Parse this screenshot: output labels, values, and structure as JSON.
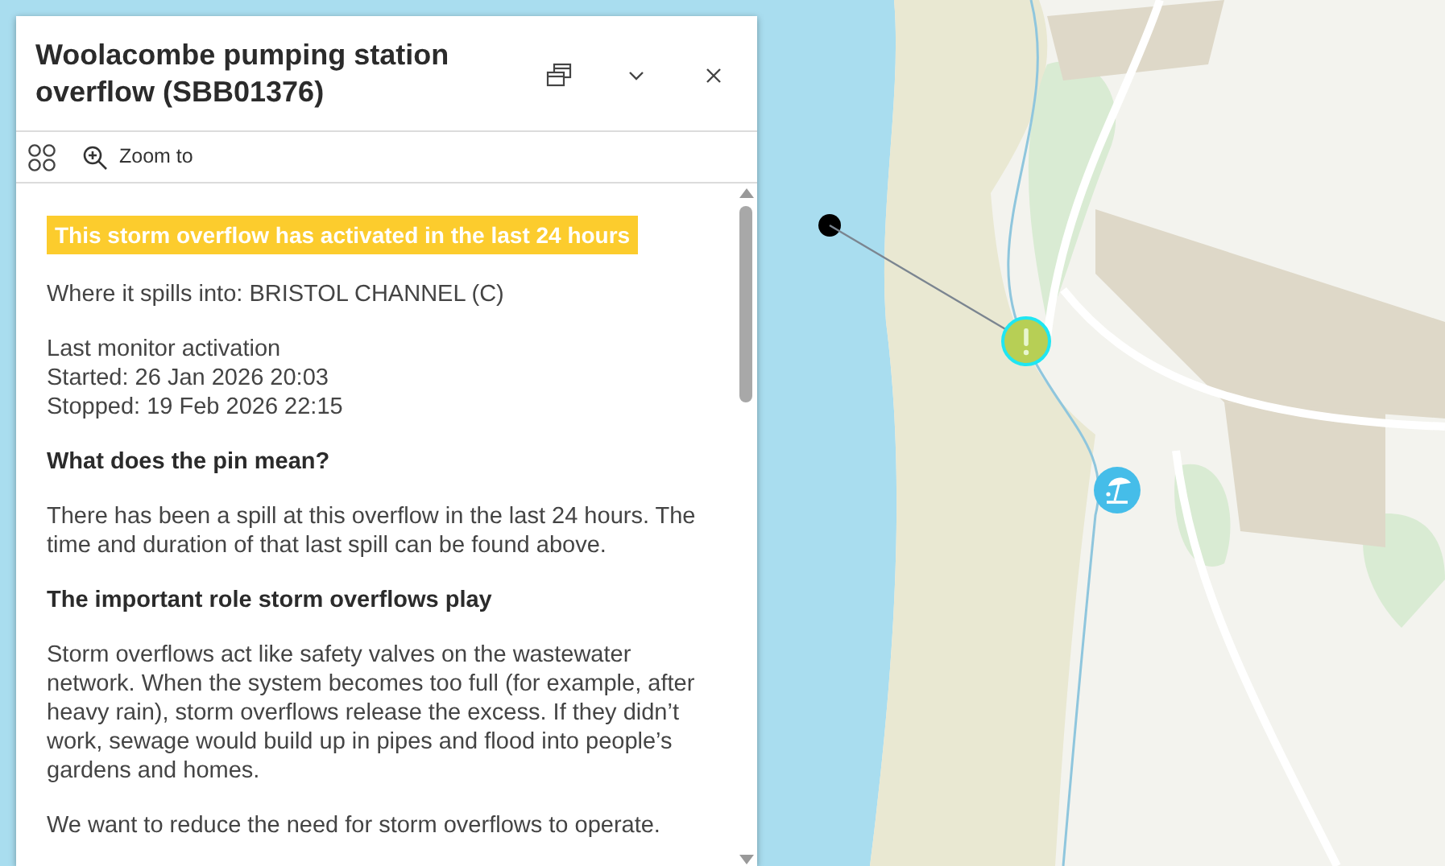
{
  "panel": {
    "title": "Woolacombe pumping station overflow (SBB01376)",
    "toolbar": [
      {
        "kind": "layout"
      },
      {
        "kind": "zoom",
        "label": "Zoom to"
      }
    ],
    "alert": "This storm overflow has activated in the last 24 hours",
    "blocks": [
      {
        "kind": "text",
        "lines": [
          "Where it spills into: BRISTOL CHANNEL (C)"
        ]
      },
      {
        "kind": "text",
        "lines": [
          "Last monitor activation",
          "Started: 26 Jan 2026 20:03",
          "Stopped: 19 Feb 2026 22:15"
        ]
      },
      {
        "kind": "heading",
        "lines": [
          "What does the pin mean?"
        ]
      },
      {
        "kind": "text",
        "lines": [
          "There has been a spill at this overflow in the last 24 hours. The time and duration of that last spill can be found above."
        ]
      },
      {
        "kind": "heading",
        "lines": [
          "The important role storm overflows play"
        ]
      },
      {
        "kind": "text",
        "lines": [
          "Storm overflows act like safety valves on the wastewater network. When the system becomes too full (for example, after heavy rain), storm overflows release the excess. If they didn’t work, sewage would build up in pipes and flood into people’s gardens and homes."
        ]
      },
      {
        "kind": "text",
        "lines": [
          "We want to reduce the need for storm overflows to operate."
        ]
      }
    ]
  },
  "markers": [
    {
      "kind": "dot"
    },
    {
      "kind": "warning"
    },
    {
      "kind": "beach"
    }
  ]
}
